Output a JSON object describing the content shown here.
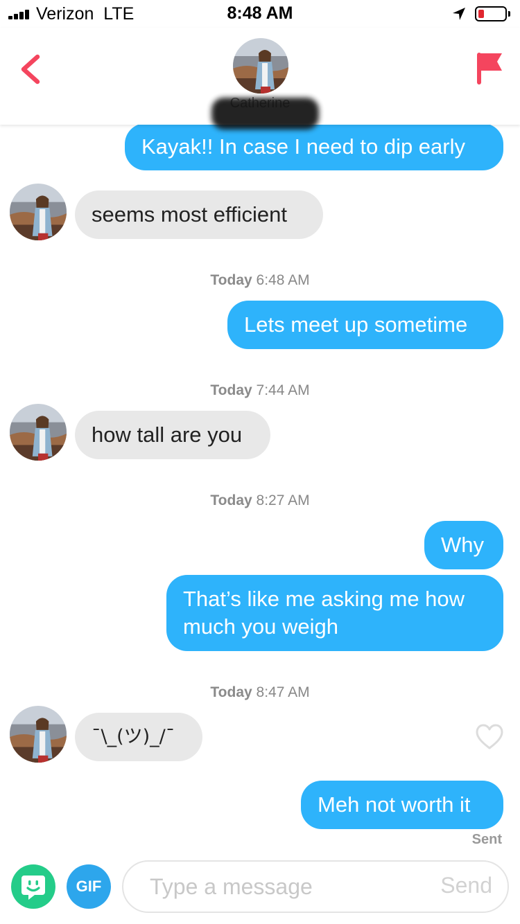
{
  "status_bar": {
    "carrier": "Verizon",
    "network": "LTE",
    "time": "8:48 AM",
    "battery_color": "#e0262f"
  },
  "header": {
    "match_name": "Catherine",
    "accent_color": "#f4455e",
    "back_icon": "chevron-left-icon",
    "report_icon": "flag-icon"
  },
  "conversation": {
    "messages": [
      {
        "side": "sent",
        "text": "Kayak!! In case I need to dip early"
      },
      {
        "side": "received",
        "text": "seems most efficient"
      },
      {
        "side": "sent",
        "text": "Lets meet up sometime"
      },
      {
        "side": "received",
        "text": "how tall are you"
      },
      {
        "side": "sent",
        "text": "Why"
      },
      {
        "side": "sent",
        "text": "That’s like me asking me how much you weigh"
      },
      {
        "side": "received",
        "text": "¯\\_(ツ)_/¯"
      },
      {
        "side": "sent",
        "text": "Meh not worth it"
      }
    ],
    "timestamps": [
      {
        "day": "Today",
        "time": "6:48 AM"
      },
      {
        "day": "Today",
        "time": "7:44 AM"
      },
      {
        "day": "Today",
        "time": "8:27 AM"
      },
      {
        "day": "Today",
        "time": "8:47 AM"
      }
    ],
    "delivery_status": "Sent",
    "sent_bubble_color": "#2eb3fb",
    "received_bubble_color": "#e8e8e8"
  },
  "composer": {
    "sticker_icon": "sticker-icon",
    "gif_label": "GIF",
    "placeholder": "Type a message",
    "send_label": "Send"
  }
}
